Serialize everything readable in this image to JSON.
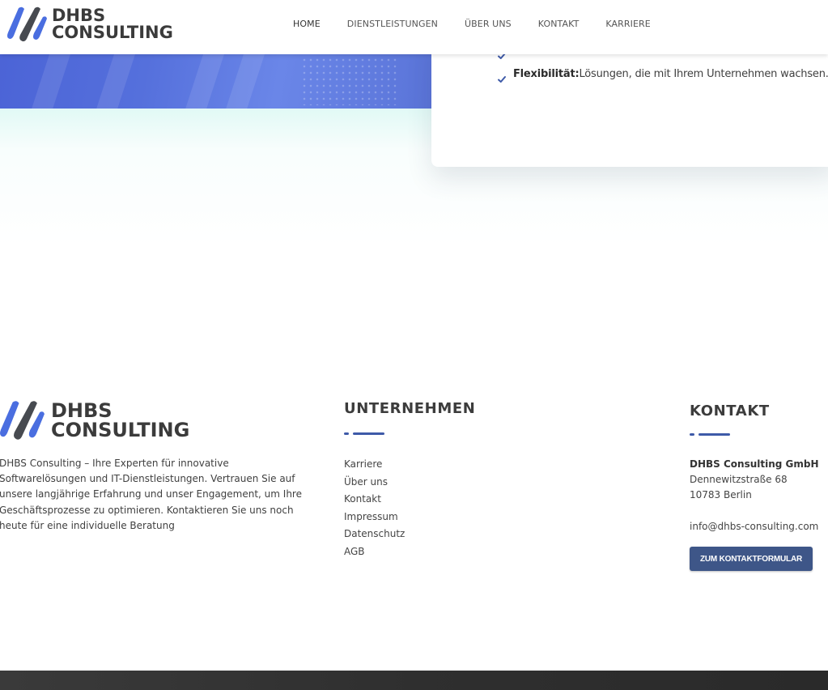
{
  "header": {
    "logo": {
      "line1": "DHBS",
      "line2": "CONSULTING"
    },
    "nav": [
      {
        "label": "HOME"
      },
      {
        "label": "DIENSTLEISTUNGEN"
      },
      {
        "label": "ÜBER UNS"
      },
      {
        "label": "KONTAKT"
      },
      {
        "label": "KARRIERE"
      }
    ]
  },
  "feature": {
    "bold": "Flexibilität:",
    "text": "Lösungen, die mit Ihrem Unternehmen wachsen."
  },
  "footer": {
    "logo": {
      "line1": "DHBS",
      "line2": "CONSULTING"
    },
    "description": "DHBS Consulting – Ihre Experten für innovative Softwarelösungen und IT-Dienstleistungen. Vertrauen Sie auf unsere langjährige Erfahrung und unser Engagement, um Ihre Geschäftsprozesse zu optimieren. Kontaktieren Sie uns noch heute für eine individuelle Beratung",
    "company_col": {
      "title": "UNTERNEHMEN",
      "links": [
        "Karriere",
        "Über uns",
        "Kontakt",
        "Impressum",
        "Datenschutz",
        "AGB"
      ]
    },
    "contact_col": {
      "title": "KONTAKT",
      "company": "DHBS Consulting GmbH",
      "street": "Dennewitzstraße 68",
      "city": "10783 Berlin",
      "email": "info@dhbs-consulting.com",
      "button": "ZUM KONTAKTFORMULAR"
    }
  },
  "colors": {
    "accent": "#3e5aa8",
    "logo_blue": "#4a6ee0",
    "logo_dark": "#474a50",
    "button_bg": "#3e5688"
  }
}
